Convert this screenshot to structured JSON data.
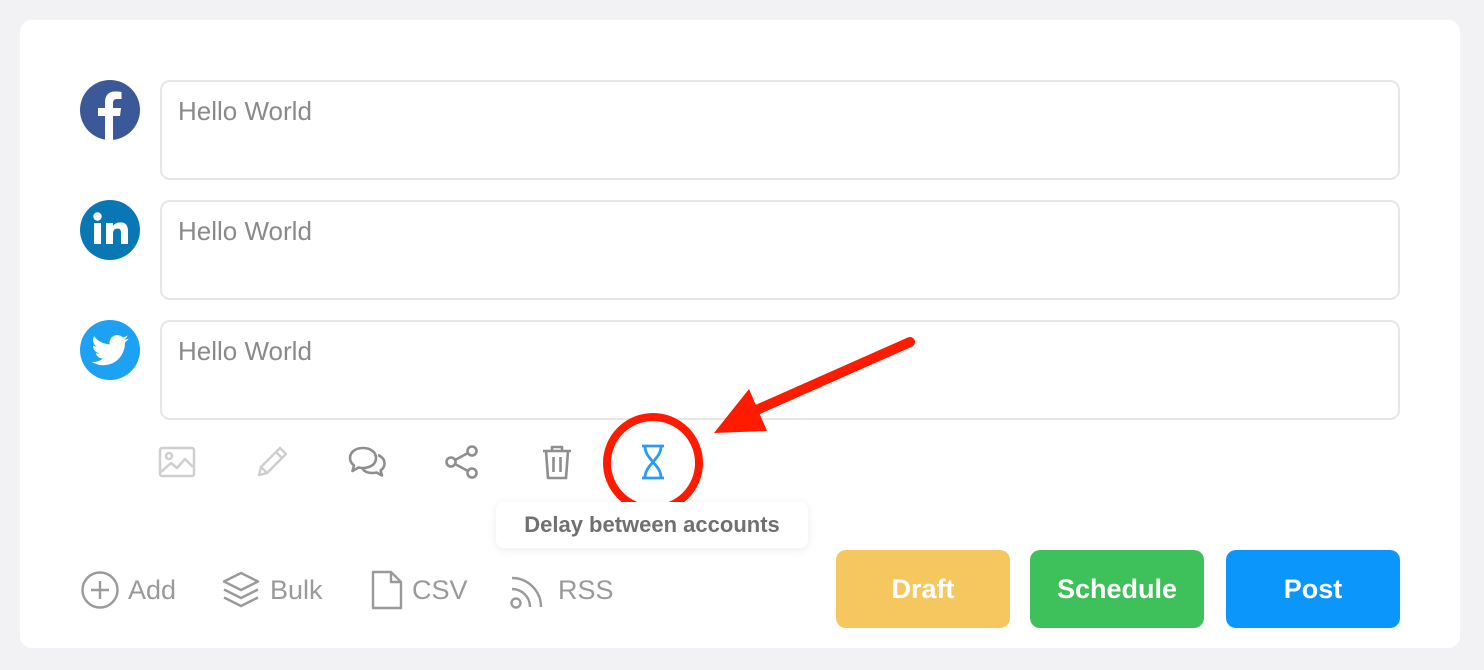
{
  "accounts": [
    {
      "network": "facebook",
      "icon": "facebook-icon",
      "text": "Hello World",
      "color": "#3b5998"
    },
    {
      "network": "linkedin",
      "icon": "linkedin-icon",
      "text": "Hello World",
      "color": "#0a77b5"
    },
    {
      "network": "twitter",
      "icon": "twitter-icon",
      "text": "Hello World",
      "color": "#1da1f2"
    }
  ],
  "toolbar": {
    "tools": [
      "image-icon",
      "pencil-icon",
      "comments-icon",
      "share-icon",
      "trash-icon",
      "hourglass-icon"
    ],
    "active_tool": "hourglass-icon",
    "active_color": "#2b9af3",
    "tooltip": "Delay between accounts"
  },
  "annotation": {
    "color": "#ff1a00"
  },
  "bottom_links": {
    "add": "Add",
    "bulk": "Bulk",
    "csv": "CSV",
    "rss": "RSS"
  },
  "buttons": {
    "draft": {
      "label": "Draft",
      "color": "#f7c75f"
    },
    "schedule": {
      "label": "Schedule",
      "color": "#3ec05b"
    },
    "post": {
      "label": "Post",
      "color": "#0b96fb"
    }
  }
}
